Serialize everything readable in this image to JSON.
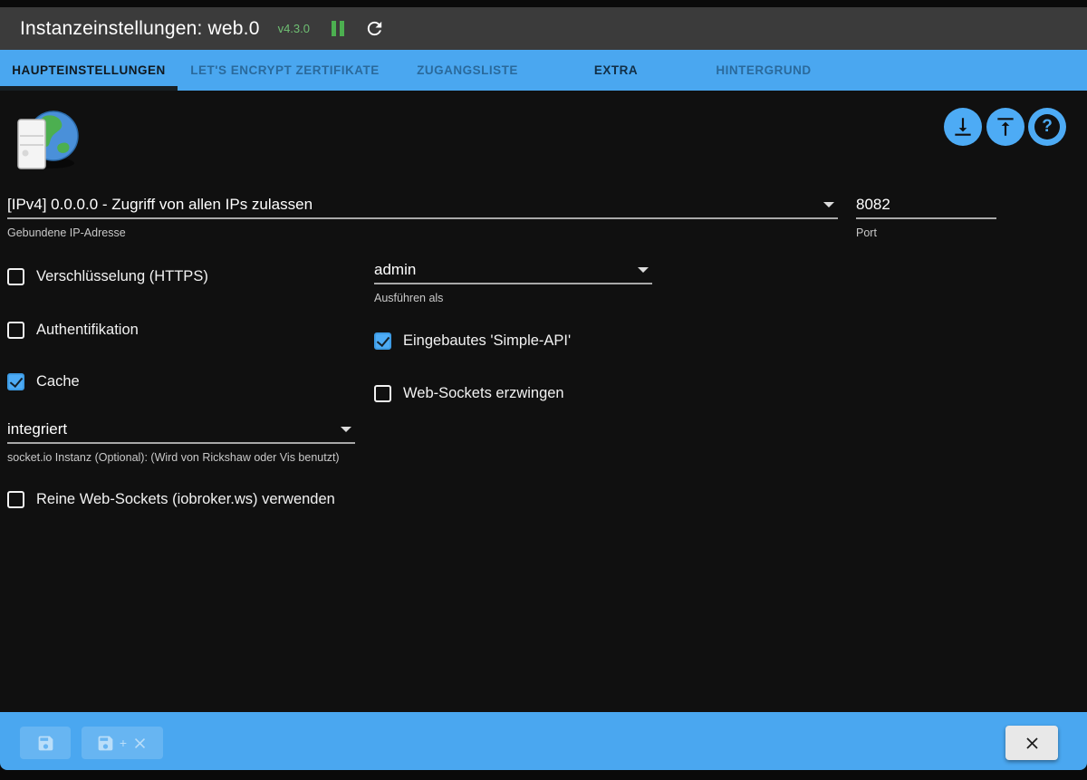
{
  "header": {
    "title": "Instanzeinstellungen: web.0",
    "version": "v4.3.0"
  },
  "tabs": [
    {
      "label": "HAUPTEINSTELLUNGEN",
      "active": true
    },
    {
      "label": "LET'S ENCRYPT ZERTIFIKATE",
      "active": false
    },
    {
      "label": "ZUGANGSLISTE",
      "active": false
    },
    {
      "label": "EXTRA",
      "active": false
    },
    {
      "label": "HINTERGRUND",
      "active": false
    }
  ],
  "toolbar": {
    "download": "download",
    "upload": "upload",
    "help": "?"
  },
  "form": {
    "ip": {
      "value": "[IPv4] 0.0.0.0 - Zugriff von allen IPs zulassen",
      "label": "Gebundene IP-Adresse"
    },
    "port": {
      "value": "8082",
      "label": "Port"
    },
    "run_as": {
      "value": "admin",
      "label": "Ausführen als"
    },
    "socketio": {
      "value": "integriert",
      "label": "socket.io Instanz (Optional): (Wird von Rickshaw oder Vis benutzt)"
    },
    "checkboxes": {
      "https": {
        "label": "Verschlüsselung (HTTPS)",
        "checked": false
      },
      "auth": {
        "label": "Authentifikation",
        "checked": false
      },
      "cache": {
        "label": "Cache",
        "checked": true
      },
      "simple_api": {
        "label": "Eingebautes 'Simple-API'",
        "checked": true
      },
      "ws_force": {
        "label": "Web-Sockets erzwingen",
        "checked": false
      },
      "pure_ws": {
        "label": "Reine Web-Sockets (iobroker.ws) verwenden",
        "checked": false
      }
    }
  },
  "footer": {
    "save_plus": "+"
  },
  "colors": {
    "accent_blue": "#4aa7f0",
    "button_blue": "#4dabf5",
    "green": "#4caf50",
    "version_green": "#6fbf73",
    "titlebar": "#3b3b3b",
    "content_bg": "#101010"
  }
}
